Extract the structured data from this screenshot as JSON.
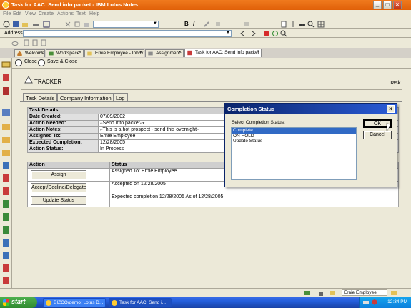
{
  "window": {
    "title": "Task for AAC: Send info packet - IBM Lotus Notes"
  },
  "menu": [
    "File",
    "Edit",
    "View",
    "Create",
    "Actions",
    "Text",
    "Help"
  ],
  "address": {
    "label": "Address"
  },
  "tabs": [
    {
      "label": "Welcome"
    },
    {
      "label": "Workspace"
    },
    {
      "label": "Ernie Employee - Inbox"
    },
    {
      "label": "Assignment"
    },
    {
      "label": "Task for AAC: Send info packet"
    }
  ],
  "actionbar": {
    "close": "Close",
    "save_close": "Save & Close"
  },
  "form": {
    "title": "TRACKER",
    "right_label": "Task",
    "tabs": [
      "Task Details",
      "Company Information",
      "Log"
    ]
  },
  "details": {
    "header": "Task Details",
    "rows": [
      {
        "label": "Date Created:",
        "value": "07/09/2002"
      },
      {
        "label": "Action Needed:",
        "value": "Send info packet"
      },
      {
        "label": "Action Notes:",
        "value": "This is a hot prospect - send this overnight"
      },
      {
        "label": "Assigned To:",
        "value": "Ernie Employee"
      },
      {
        "label": "Expected Completion:",
        "value": "12/28/2005"
      },
      {
        "label": "Action Status:",
        "value": "In Process"
      }
    ]
  },
  "actions_table": {
    "headers": [
      "Action",
      "Status"
    ],
    "rows": [
      {
        "button": "Assign",
        "status": "Assigned To: Ernie Employee"
      },
      {
        "button": "Accept/Decline/Delegate",
        "status": "Accepted on 12/28/2005"
      },
      {
        "button": "Update Status",
        "status": "Expected completion 12/28/2005 As of 12/28/2005"
      }
    ]
  },
  "dialog": {
    "title": "Completion Status",
    "prompt": "Select Completion Status:",
    "options": [
      "Complete",
      "ON HOLD",
      "Update  Status"
    ],
    "selected": "Complete",
    "ok": "OK",
    "cancel": "Cancel"
  },
  "status": {
    "user": "Ernie Employee"
  },
  "taskbar": {
    "start": "start",
    "items": [
      {
        "label": "BIZCO/demo: Lotus D..."
      },
      {
        "label": "Task for AAC: Send i..."
      }
    ],
    "clock": "12:34 PM"
  }
}
